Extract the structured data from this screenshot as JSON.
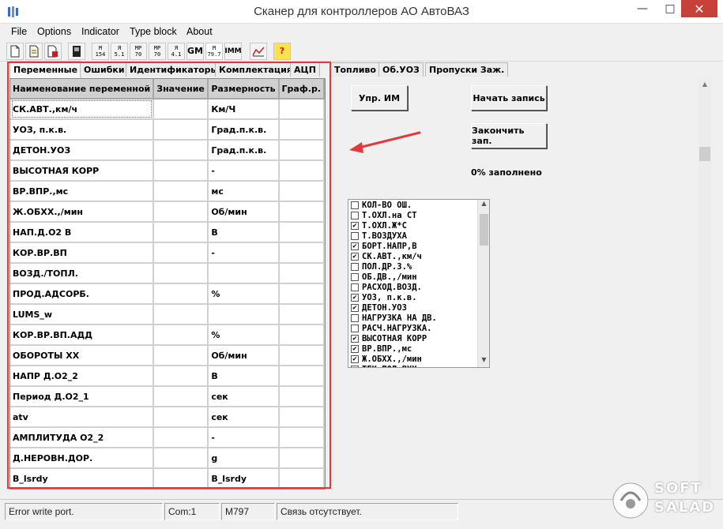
{
  "window": {
    "title": "Сканер для  контроллеров АО АвтоВАЗ"
  },
  "menu": [
    "File",
    "Options",
    "Indicator",
    "Type block",
    "About"
  ],
  "toolbar": {
    "buttons": [
      {
        "id": "new",
        "label": ""
      },
      {
        "id": "open",
        "label": ""
      },
      {
        "id": "save",
        "label": ""
      },
      {
        "id": "device",
        "label": ""
      },
      {
        "id": "m154",
        "label": "M\n154"
      },
      {
        "id": "ya51",
        "label": "Я\n5.1"
      },
      {
        "id": "mp70a",
        "label": "MP\n70"
      },
      {
        "id": "mp70b",
        "label": "MP\n70"
      },
      {
        "id": "ya41",
        "label": "Я\n4.1"
      },
      {
        "id": "gm",
        "label": "GM"
      },
      {
        "id": "m797",
        "label": "M\n79.7"
      },
      {
        "id": "imm",
        "label": "IMM"
      },
      {
        "id": "chart",
        "label": ""
      },
      {
        "id": "help",
        "label": "?"
      }
    ]
  },
  "tabs": [
    "Переменные",
    "Ошибки",
    "Идентификаторы",
    "Комплектация",
    "АЦП",
    "Топливо",
    "Об.УОЗ",
    "Пропуски Заж."
  ],
  "grid": {
    "headers": [
      "Наименование переменной",
      "Значение",
      "Размерность",
      "Граф.р."
    ],
    "rows": [
      [
        "СК.АВТ.,км/ч",
        "",
        "Км/Ч",
        ""
      ],
      [
        "УОЗ, п.к.в.",
        "",
        "Град.п.к.в.",
        ""
      ],
      [
        "ДЕТОН.УОЗ",
        "",
        "Град.п.к.в.",
        ""
      ],
      [
        "ВЫСОТНАЯ КОРР",
        "",
        "-",
        ""
      ],
      [
        "ВР.ВПР.,мс",
        "",
        "мс",
        ""
      ],
      [
        "Ж.ОБХХ.,/мин",
        "",
        "Об/мин",
        ""
      ],
      [
        "НАП.Д.О2 В",
        "",
        "В",
        ""
      ],
      [
        "КОР.ВР.ВП",
        "",
        "-",
        ""
      ],
      [
        "ВОЗД./ТОПЛ.",
        "",
        "",
        ""
      ],
      [
        "ПРОД.АДСОРБ.",
        "",
        "%",
        ""
      ],
      [
        "LUMS_w",
        "",
        "",
        ""
      ],
      [
        "КОР.ВР.ВП.АДД",
        "",
        "%",
        ""
      ],
      [
        "ОБОРОТЫ ХХ",
        "",
        "Об/мин",
        ""
      ],
      [
        "НАПР Д.О2_2",
        "",
        "В",
        ""
      ],
      [
        "Период Д.О2_1",
        "",
        "сек",
        ""
      ],
      [
        "atv",
        "",
        "сек",
        ""
      ],
      [
        "АМПЛИТУДА О2_2",
        "",
        "-",
        ""
      ],
      [
        "Д.НЕРОВН.ДОР.",
        "",
        "g",
        ""
      ],
      [
        "B_lsrdy",
        "",
        "B_lsrdy",
        ""
      ]
    ]
  },
  "controls": {
    "upr_im": "Упр. ИМ",
    "start_record": "Начать запись",
    "stop_record": "Закончить зап.",
    "fill_status": "0% заполнено"
  },
  "checklist": [
    {
      "label": "КОЛ-ВО ОШ.",
      "checked": false
    },
    {
      "label": "Т.ОХЛ.на СТ",
      "checked": false
    },
    {
      "label": "Т.ОХЛ.Ж*С",
      "checked": true
    },
    {
      "label": "Т.ВОЗДУХА",
      "checked": false
    },
    {
      "label": "БОРТ.НАПР,В",
      "checked": true
    },
    {
      "label": "СК.АВТ.,км/ч",
      "checked": true
    },
    {
      "label": "ПОЛ.ДР.З.%",
      "checked": false
    },
    {
      "label": "ОБ.ДВ.,/мин",
      "checked": false
    },
    {
      "label": "РАСХОД.ВОЗД.",
      "checked": false
    },
    {
      "label": "УОЗ, п.к.в.",
      "checked": true
    },
    {
      "label": "ДЕТОН.УОЗ",
      "checked": true
    },
    {
      "label": "НАГРУЗКА НА ДВ.",
      "checked": false
    },
    {
      "label": "РАСЧ.НАГРУЗКА.",
      "checked": false
    },
    {
      "label": "ВЫСОТНАЯ КОРР",
      "checked": true
    },
    {
      "label": "ВР.ВПР.,мс",
      "checked": true
    },
    {
      "label": "Ж.ОБХХ.,/мин",
      "checked": true
    },
    {
      "label": "ТЕК.ПОЛ.РХХ",
      "checked": false
    }
  ],
  "status": {
    "message": "Error write port.",
    "port": "Com:1",
    "block": "M797",
    "connection": "Связь отсутствует."
  },
  "watermark": {
    "line1": "SOFT",
    "line2": "SALAD"
  },
  "colors": {
    "highlight": "#e03a3a",
    "arrow": "#e03a3a",
    "close": "#c7413a"
  }
}
